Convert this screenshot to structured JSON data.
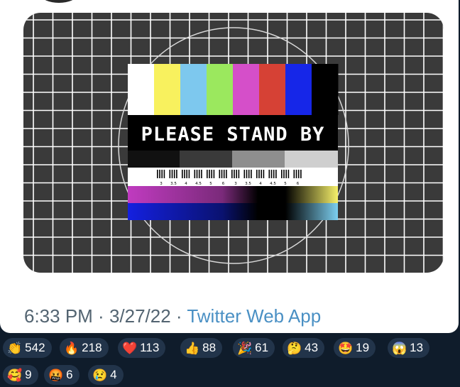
{
  "tweet": {
    "time": "6:33 PM",
    "sep1": " · ",
    "date": "3/27/22",
    "sep2": " · ",
    "source": "Twitter Web App"
  },
  "image": {
    "banner_text": "PLEASE STAND BY",
    "tick_labels": [
      "3",
      "3.5",
      "4",
      "4.5",
      "5",
      "6",
      "3",
      "3.5",
      "4",
      "4.5",
      "5",
      "6"
    ],
    "color_bars": [
      "#ffffff",
      "#f8f15e",
      "#7dc8ee",
      "#9be85e",
      "#d54fc9",
      "#d64135",
      "#1626e8",
      "#000000"
    ]
  },
  "reactions": [
    {
      "emoji": "👏",
      "count": "542"
    },
    {
      "emoji": "🔥",
      "count": "218"
    },
    {
      "emoji": "❤️",
      "count": "113"
    },
    {
      "emoji": "👍",
      "count": "88"
    },
    {
      "emoji": "🎉",
      "count": "61"
    },
    {
      "emoji": "🤔",
      "count": "43"
    },
    {
      "emoji": "🤩",
      "count": "19"
    },
    {
      "emoji": "😱",
      "count": "13"
    },
    {
      "emoji": "🥰",
      "count": "9"
    },
    {
      "emoji": "🤬",
      "count": "6"
    },
    {
      "emoji": "😢",
      "count": "4"
    }
  ]
}
